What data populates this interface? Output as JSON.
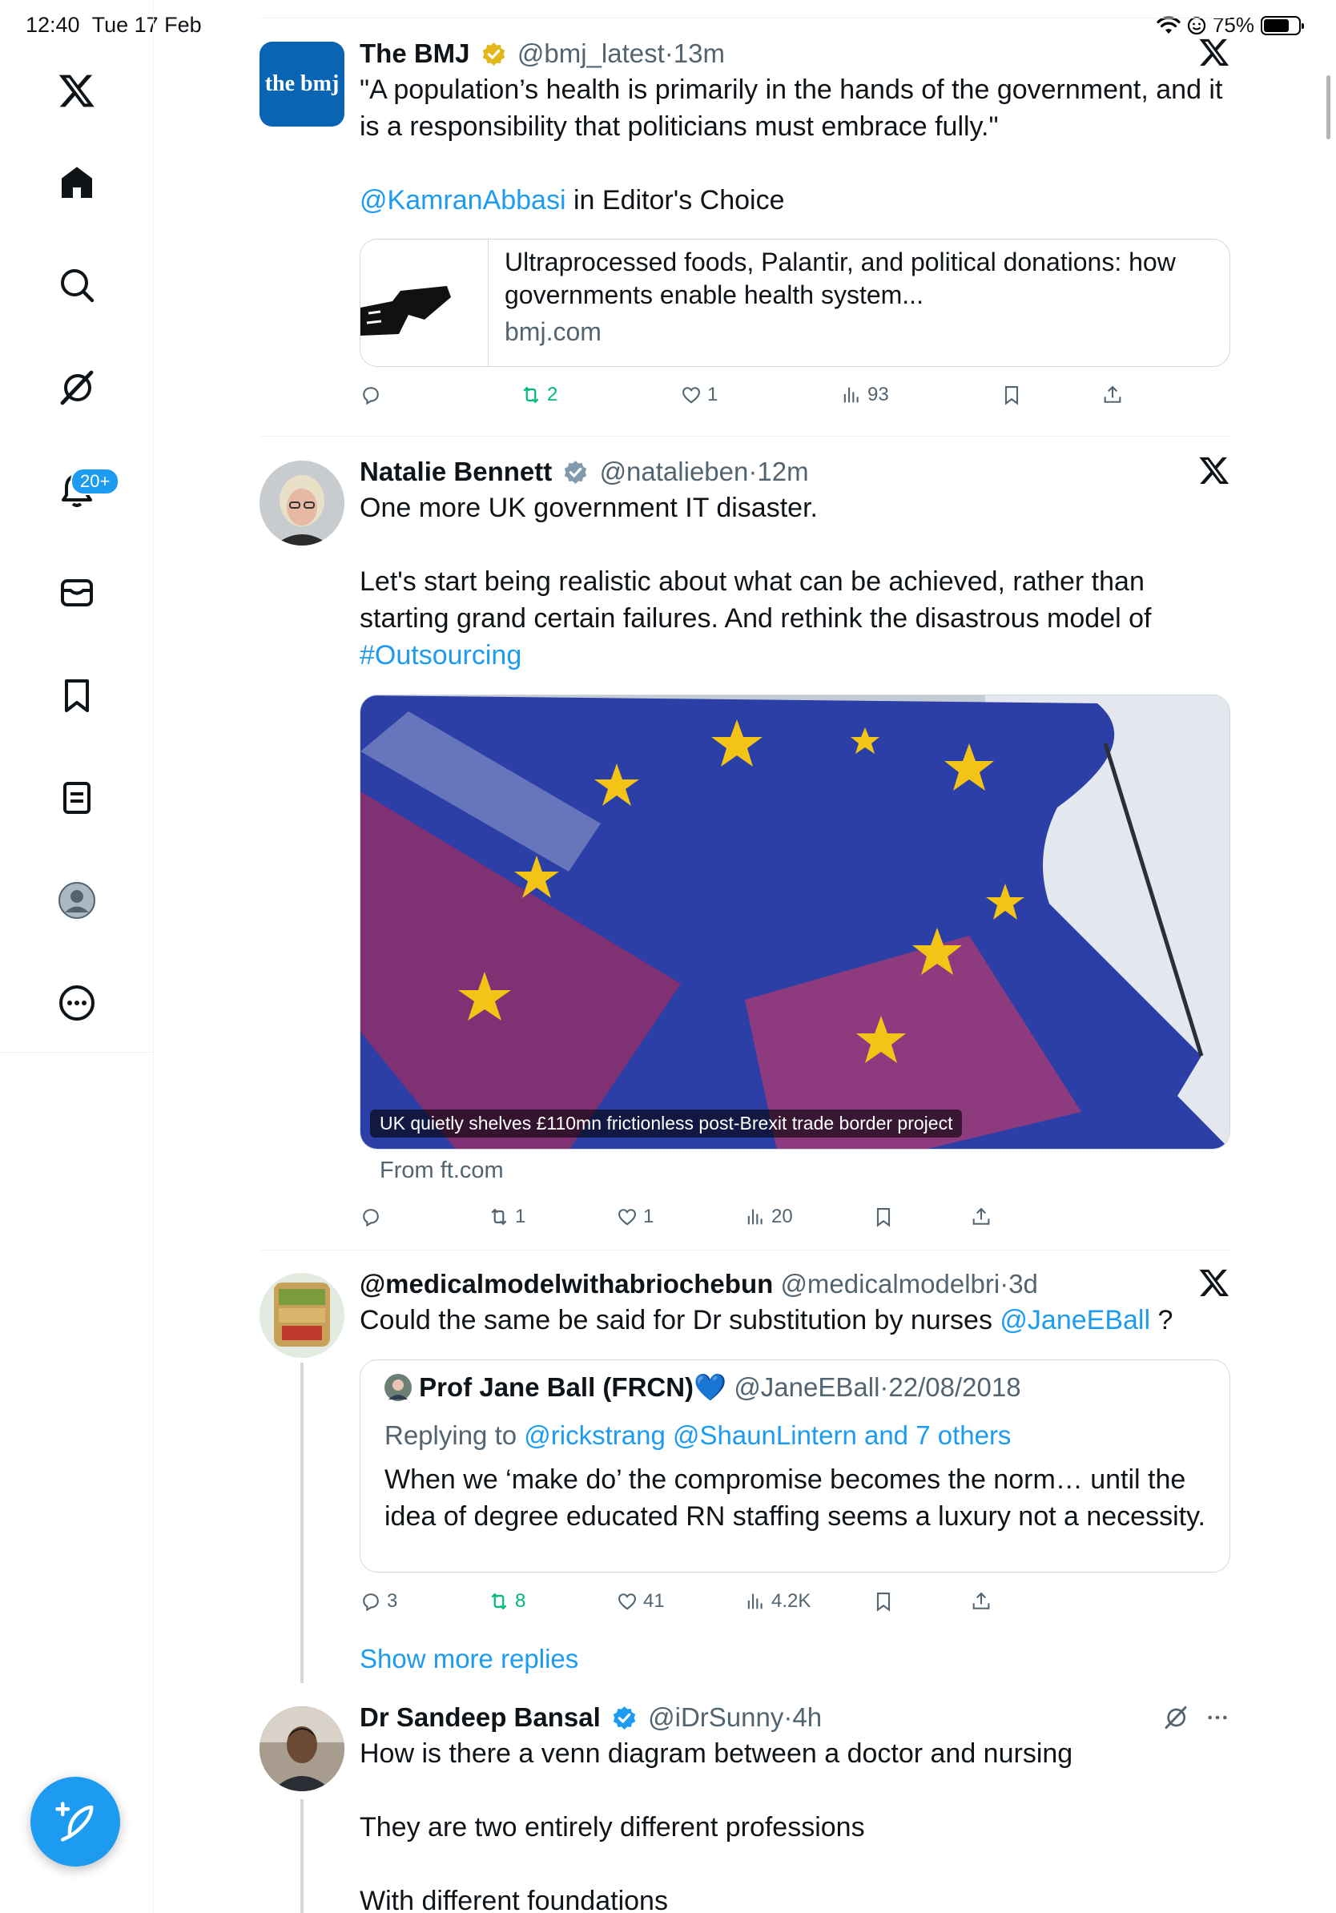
{
  "status_bar": {
    "time": "12:40",
    "date": "Tue 17 Feb",
    "battery": "75%"
  },
  "sidebar": {
    "items": [
      {
        "icon": "x-logo-icon"
      },
      {
        "icon": "home-icon"
      },
      {
        "icon": "search-icon"
      },
      {
        "icon": "grok-icon"
      },
      {
        "icon": "bell-icon",
        "badge": "20+"
      },
      {
        "icon": "messages-icon"
      },
      {
        "icon": "bookmark-icon"
      },
      {
        "icon": "lists-icon"
      },
      {
        "icon": "profile-icon"
      },
      {
        "icon": "more-icon"
      }
    ],
    "compose_icon": "compose-icon"
  },
  "tweets": [
    {
      "name": "The BMJ",
      "handle": "@bmj_latest",
      "time": "13m",
      "avatar_text": "the bmj",
      "text_1": "\"A population’s health is primarily in the hands of the government, and it is a responsibility that politicians must embrace fully.\"",
      "mention": "@KamranAbbasi",
      "text_2": " in Editor's Choice",
      "card": {
        "title": "Ultraprocessed foods, Palantir, and political donations: how governments enable health system...",
        "domain": "bmj.com"
      },
      "actions": {
        "replies": "",
        "retweets": "2",
        "likes": "1",
        "views": "93"
      }
    },
    {
      "name": "Natalie Bennett",
      "handle": "@natalieben",
      "time": "12m",
      "text_1": "One more UK government IT disaster.",
      "text_2": "Let's start being realistic about what can be achieved, rather than starting grand certain failures. And rethink the disastrous model of",
      "hashtag": "#Outsourcing",
      "media_caption": "UK quietly shelves £110mn frictionless post-Brexit trade border project",
      "from": "From ft.com",
      "actions": {
        "replies": "",
        "retweets": "1",
        "likes": "1",
        "views": "20"
      }
    },
    {
      "name": "@medicalmodelwithabriochebun",
      "handle": "@medicalmodelbri",
      "time": "3d",
      "text_1": "Could the same be said for Dr substitution by nurses ",
      "mention": "@JaneEBall",
      "text_2": " ?",
      "quote": {
        "name": "Prof Jane Ball (FRCN)💙",
        "handle": "@JaneEBall",
        "time": "22/08/2018",
        "replying_prefix": "Replying to ",
        "replying_to": "@rickstrang @ShaunLintern and 7 others",
        "text": "When we ‘make do’ the compromise becomes the norm… until the idea of degree educated RN staffing seems a luxury not a necessity."
      },
      "actions": {
        "replies": "3",
        "retweets": "8",
        "likes": "41",
        "views": "4.2K"
      },
      "show_more": "Show more replies"
    },
    {
      "name": "Dr Sandeep Bansal",
      "handle": "@iDrSunny",
      "time": "4h",
      "text_1": "How is there a venn diagram between a doctor and nursing",
      "text_2": "They are two entirely different professions",
      "text_3": "With different foundations"
    }
  ],
  "separator": "·"
}
